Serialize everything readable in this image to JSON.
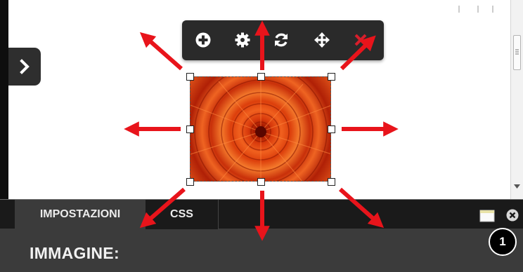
{
  "colors": {
    "annotation_arrow": "#e8141b",
    "toolbar_bg": "#2a2a2a",
    "panel_bg": "#3b3b3b",
    "tabbar_bg": "#1a1a1a",
    "toolbar_close": "#d71e2b"
  },
  "sidebar_toggle": {
    "icon": "chevron-right-icon"
  },
  "toolbar": {
    "buttons": [
      {
        "icon": "plus-circle-icon"
      },
      {
        "icon": "gear-icon"
      },
      {
        "icon": "refresh-icon"
      },
      {
        "icon": "move-icon"
      },
      {
        "icon": "close-x-icon"
      }
    ]
  },
  "image": {
    "icon": "flower-image",
    "handles": 8
  },
  "panel": {
    "tabs": [
      {
        "label": "IMPOSTAZIONI",
        "active": true
      },
      {
        "label": "CSS",
        "active": false
      }
    ],
    "heading": "IMMAGINE:",
    "window_icon": "window-icon",
    "close_icon": "close-circle-icon"
  },
  "step_badge": "1"
}
